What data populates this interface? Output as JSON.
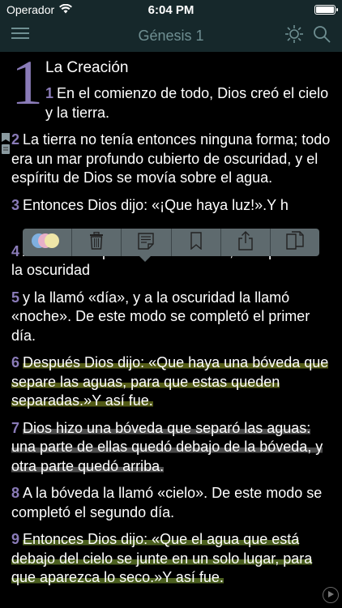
{
  "status": {
    "carrier": "Operador",
    "time": "6:04 PM",
    "battery_level": 1.0
  },
  "nav": {
    "title": "Génesis 1",
    "menu_icon": "hamburger-menu-icon",
    "brightness_icon": "sun-icon",
    "search_icon": "search-icon"
  },
  "chapter": {
    "number": "1",
    "section_title": "La Creación",
    "verses": [
      {
        "num": "1",
        "text": "En el comienzo de todo, Dios creó el cielo y la tierra."
      },
      {
        "num": "2",
        "text": "La tierra no tenía entonces ninguna forma; todo era un mar profundo cubierto de oscuridad, y el espíritu de Dios se movía sobre el agua."
      },
      {
        "num": "3",
        "text": "Entonces Dios dijo: «¡Que haya luz!».Y h"
      },
      {
        "num": "4",
        "text": "Al ver Dios que la luz era buena, la separó de la oscuridad"
      },
      {
        "num": "5",
        "text": "y la llamó «día», y a la oscuridad la llamó «noche». De este modo se completó el primer día."
      },
      {
        "num": "6",
        "text": "Después Dios dijo: «Que haya una bóveda que separe las aguas, para que estas queden separadas.»Y así fue."
      },
      {
        "num": "7",
        "text": "Dios hizo una bóveda que separó las aguas: una parte de ellas quedó debajo de la bóveda, y otra parte quedó arriba."
      },
      {
        "num": "8",
        "text": "A la bóveda la llamó «cielo». De este modo se completó el segundo día."
      },
      {
        "num": "9",
        "text": "Entonces Dios dijo: «Que el agua que está debajo del cielo se junte en un solo lugar, para que aparezca lo seco.»Y así fue."
      }
    ]
  },
  "toolbar": {
    "items": [
      "color-palette-icon",
      "trash-icon",
      "note-icon",
      "bookmark-icon",
      "share-icon",
      "copy-icon"
    ]
  },
  "colors": {
    "accent": "#8a7bb8",
    "bar": "#16282b",
    "toolbar": "#5e6a6e"
  }
}
